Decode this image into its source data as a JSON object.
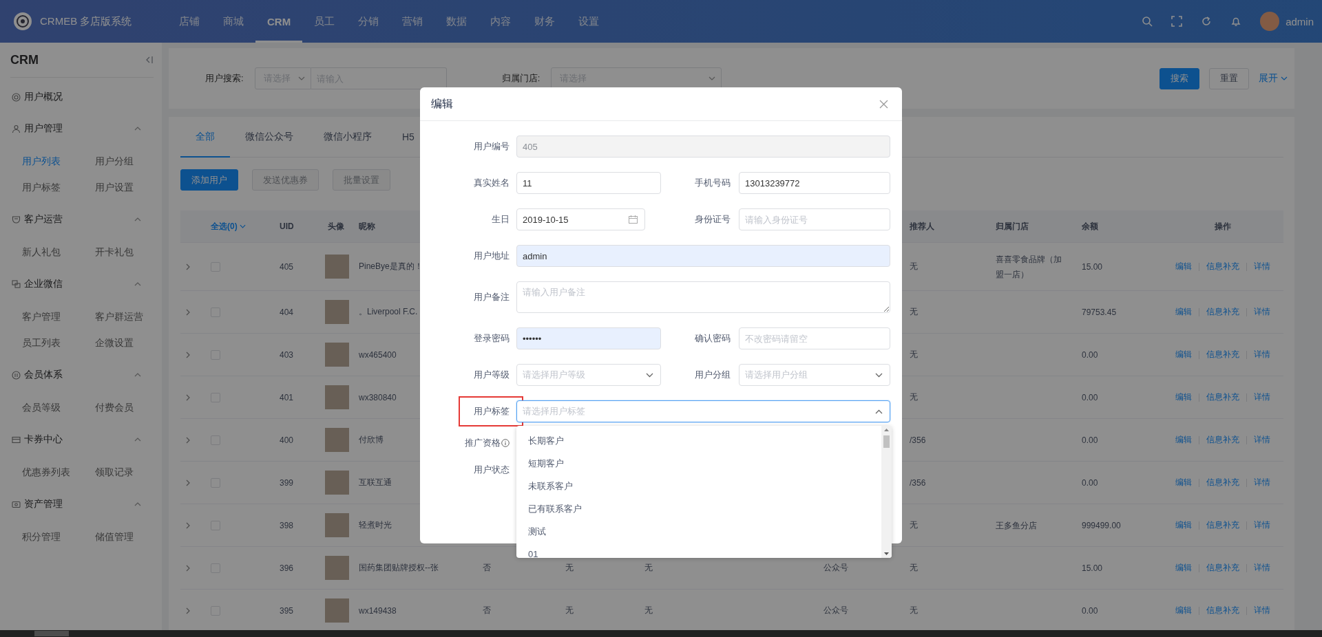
{
  "topbar": {
    "brand": "CRMEB 多店版系统",
    "nav": [
      {
        "label": "店铺",
        "selected": false
      },
      {
        "label": "商城",
        "selected": false
      },
      {
        "label": "CRM",
        "selected": true
      },
      {
        "label": "员工",
        "selected": false
      },
      {
        "label": "分销",
        "selected": false
      },
      {
        "label": "营销",
        "selected": false
      },
      {
        "label": "数据",
        "selected": false
      },
      {
        "label": "内容",
        "selected": false
      },
      {
        "label": "财务",
        "selected": false
      },
      {
        "label": "设置",
        "selected": false
      }
    ],
    "user": "admin"
  },
  "sidebar": {
    "title": "CRM",
    "groups": [
      {
        "label": "用户概况",
        "kind": "link"
      },
      {
        "label": "用户管理",
        "kind": "group",
        "expanded": true,
        "items": [
          {
            "label": "用户列表",
            "selected": true
          },
          {
            "label": "用户分组",
            "selected": false
          },
          {
            "label": "用户标签",
            "selected": false
          },
          {
            "label": "用户设置",
            "selected": false
          }
        ]
      },
      {
        "label": "客户运营",
        "kind": "group",
        "expanded": true,
        "items": [
          {
            "label": "新人礼包",
            "selected": false
          },
          {
            "label": "开卡礼包",
            "selected": false
          }
        ]
      },
      {
        "label": "企业微信",
        "kind": "group",
        "expanded": true,
        "items": [
          {
            "label": "客户管理",
            "selected": false
          },
          {
            "label": "客户群运营",
            "selected": false
          },
          {
            "label": "员工列表",
            "selected": false
          },
          {
            "label": "企微设置",
            "selected": false
          }
        ]
      },
      {
        "label": "会员体系",
        "kind": "group",
        "expanded": true,
        "items": [
          {
            "label": "会员等级",
            "selected": false
          },
          {
            "label": "付费会员",
            "selected": false
          }
        ]
      },
      {
        "label": "卡券中心",
        "kind": "group",
        "expanded": true,
        "items": [
          {
            "label": "优惠券列表",
            "selected": false
          },
          {
            "label": "领取记录",
            "selected": false
          }
        ]
      },
      {
        "label": "资产管理",
        "kind": "group",
        "expanded": true,
        "items": [
          {
            "label": "积分管理",
            "selected": false
          },
          {
            "label": "储值管理",
            "selected": false
          }
        ]
      }
    ]
  },
  "filter": {
    "fields": [
      {
        "label": "用户搜索:",
        "select_placeholder": "请选择",
        "placeholder": "请输入"
      },
      {
        "label": "归属门店:",
        "select_placeholder": "请选择"
      }
    ],
    "buttons": [
      {
        "label": "搜索",
        "kind": "primary"
      },
      {
        "label": "重置",
        "kind": "default"
      }
    ],
    "toggle": "展开"
  },
  "tabs": [
    {
      "label": "全部",
      "selected": true
    },
    {
      "label": "微信公众号",
      "selected": false
    },
    {
      "label": "微信小程序",
      "selected": false
    },
    {
      "label": "H5",
      "selected": false
    }
  ],
  "actions": [
    {
      "label": "添加用户",
      "kind": "primary",
      "disabled": false
    },
    {
      "label": "发送优惠券",
      "kind": "default",
      "disabled": true
    },
    {
      "label": "批量设置",
      "kind": "default",
      "disabled": true
    }
  ],
  "table": {
    "select_all": "全选(0)",
    "columns": [
      "UID",
      "头像",
      "昵称",
      "推荐人",
      "归属门店",
      "余额",
      "操作"
    ],
    "rows": [
      {
        "uid": "405",
        "nickname": "PineBye是真的！",
        "checked": false,
        "referrer": "无",
        "store": "喜喜零食品牌（加盟一店）",
        "balance": "15.00",
        "actions": [
          "编辑",
          "信息补充",
          "详情"
        ]
      },
      {
        "uid": "404",
        "nickname": "。Liverpool F.C.",
        "checked": false,
        "referrer": "无",
        "balance": "79753.45",
        "actions": [
          "编辑",
          "信息补充",
          "详情"
        ]
      },
      {
        "uid": "403",
        "nickname": "wx465400",
        "checked": false,
        "referrer": "无",
        "balance": "0.00",
        "actions": [
          "编辑",
          "信息补充",
          "详情"
        ]
      },
      {
        "uid": "401",
        "nickname": "wx380840",
        "checked": false,
        "referrer": "无",
        "balance": "0.00",
        "actions": [
          "编辑",
          "信息补充",
          "详情"
        ]
      },
      {
        "uid": "400",
        "nickname": "付欣博",
        "checked": false,
        "referrer": "/356",
        "balance": "0.00",
        "actions": [
          "编辑",
          "信息补充",
          "详情"
        ]
      },
      {
        "uid": "399",
        "nickname": "互联互通",
        "checked": false,
        "referrer": "/356",
        "balance": "0.00",
        "actions": [
          "编辑",
          "信息补充",
          "详情"
        ]
      },
      {
        "uid": "398",
        "nickname": "轻煮时光",
        "checked": false,
        "referrer": "无",
        "store": "王多鱼分店",
        "balance": "999499.00",
        "actions": [
          "编辑",
          "信息补充",
          "详情"
        ]
      },
      {
        "uid": "396",
        "nickname": "国药集团贴牌授权--张",
        "checked": false,
        "cells": {
          "column_5": "否",
          "column_6": "无",
          "column_7": "无",
          "column_9": "公众号"
        },
        "referrer": "无",
        "balance": "15.00",
        "actions": [
          "编辑",
          "信息补充",
          "详情"
        ]
      },
      {
        "uid": "395",
        "nickname": "wx149438",
        "checked": false,
        "cells": {
          "column_5": "否",
          "column_6": "无",
          "column_7": "无",
          "column_9": "公众号"
        },
        "referrer": "无",
        "balance": "0.00",
        "actions": [
          "编辑",
          "信息补充",
          "详情"
        ]
      }
    ]
  },
  "modal": {
    "title": "编辑",
    "rows": [
      {
        "fields": [
          {
            "label": "用户编号",
            "kind": "text",
            "value": "405",
            "disabled": true
          }
        ]
      },
      {
        "fields": [
          {
            "label": "真实姓名",
            "kind": "text",
            "value": "11"
          },
          {
            "label": "手机号码",
            "kind": "text",
            "value": "13013239772"
          }
        ]
      },
      {
        "fields": [
          {
            "label": "生日",
            "kind": "date",
            "value": "2019-10-15"
          },
          {
            "label": "身份证号",
            "kind": "text",
            "placeholder": "请输入身份证号"
          }
        ]
      },
      {
        "fields": [
          {
            "label": "用户地址",
            "kind": "text",
            "value": "admin",
            "autofilled": true
          }
        ]
      },
      {
        "fields": [
          {
            "label": "用户备注",
            "kind": "textarea",
            "placeholder": "请输入用户备注"
          }
        ]
      },
      {
        "fields": [
          {
            "label": "登录密码",
            "kind": "text",
            "value": "••••••",
            "autofilled": true
          },
          {
            "label": "确认密码",
            "kind": "text",
            "placeholder": "不改密码请留空"
          }
        ]
      },
      {
        "fields": [
          {
            "label": "用户等级",
            "kind": "select",
            "placeholder": "请选择用户等级",
            "open": false
          },
          {
            "label": "用户分组",
            "kind": "select",
            "placeholder": "请选择用户分组",
            "open": false
          }
        ]
      },
      {
        "fields": [
          {
            "label": "用户标签",
            "kind": "select",
            "placeholder": "请选择用户标签",
            "open": true,
            "highlighted": true,
            "options": [
              {
                "label": "长期客户",
                "selected": false
              },
              {
                "label": "短期客户",
                "selected": false
              },
              {
                "label": "未联系客户",
                "selected": false
              },
              {
                "label": "已有联系客户",
                "selected": false
              },
              {
                "label": "测试",
                "selected": false
              },
              {
                "label": "01",
                "selected": false
              }
            ]
          }
        ]
      },
      {
        "fields": [
          {
            "label": "推广资格",
            "kind": "label_only",
            "info": true
          }
        ]
      },
      {
        "fields": [
          {
            "label": "用户状态",
            "kind": "label_only"
          }
        ]
      }
    ]
  }
}
